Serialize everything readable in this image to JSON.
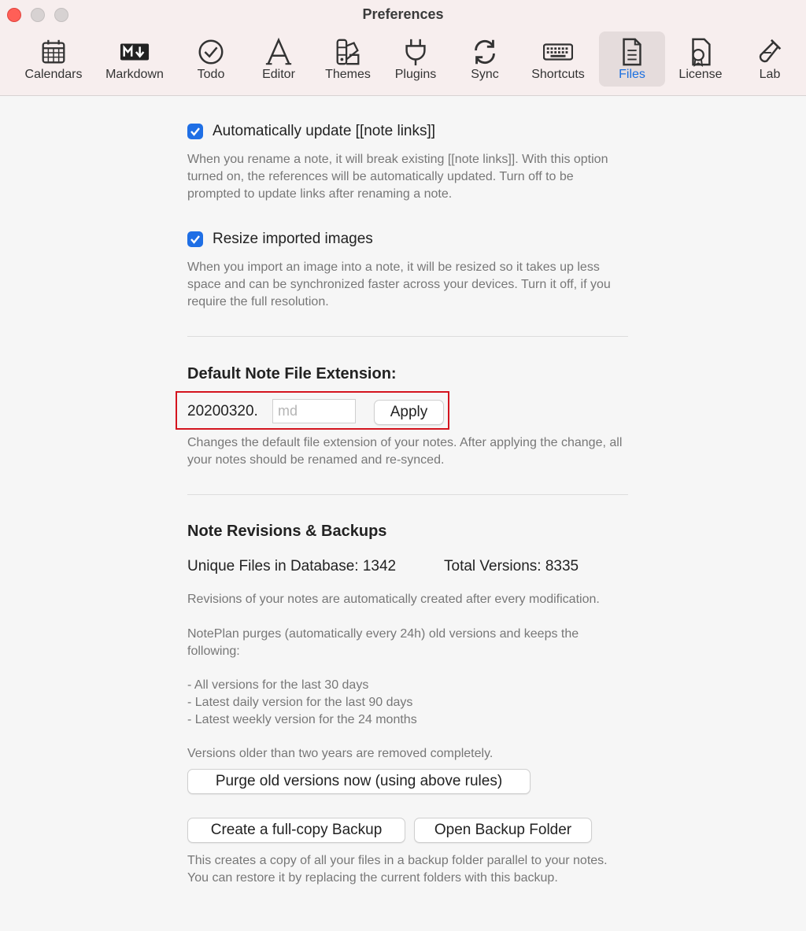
{
  "window": {
    "title": "Preferences"
  },
  "toolbar": {
    "items": [
      {
        "label": "Calendars",
        "icon": "calendar-icon"
      },
      {
        "label": "Markdown",
        "icon": "markdown-icon"
      },
      {
        "label": "Todo",
        "icon": "todo-check-icon"
      },
      {
        "label": "Editor",
        "icon": "editor-font-icon"
      },
      {
        "label": "Themes",
        "icon": "themes-palette-icon"
      },
      {
        "label": "Plugins",
        "icon": "plugin-plug-icon"
      },
      {
        "label": "Sync",
        "icon": "sync-icon"
      },
      {
        "label": "Shortcuts",
        "icon": "keyboard-icon"
      },
      {
        "label": "Files",
        "icon": "file-icon",
        "active": true
      },
      {
        "label": "License",
        "icon": "license-icon"
      },
      {
        "label": "Lab",
        "icon": "lab-flask-icon"
      }
    ],
    "active_color": "#1a6fe0"
  },
  "settings": {
    "update_links": {
      "label": "Automatically update [[note links]]",
      "checked": true,
      "description": "When you rename a note, it will break existing [[note links]]. With this option turned on, the references will be automatically updated. Turn off to be prompted to update links after renaming a note."
    },
    "resize_images": {
      "label": "Resize imported images",
      "checked": true,
      "description": "When you import an image into a note, it will be resized so it takes up less space and can be synchronized faster across your devices. Turn it off, if you require the full resolution."
    }
  },
  "extension": {
    "heading": "Default Note File Extension:",
    "prefix": "20200320.",
    "value": "",
    "placeholder": "md",
    "apply_label": "Apply",
    "description": "Changes the default file extension of your notes. After applying the change, all your notes should be renamed and re-synced."
  },
  "revisions": {
    "heading": "Note Revisions & Backups",
    "unique_files": "Unique Files in Database: 1342",
    "total_versions": "Total Versions: 8335",
    "desc_1": "Revisions of your notes are automatically created after every modification.",
    "desc_2": "NotePlan purges (automatically every 24h) old versions and keeps the following:",
    "rules": [
      "- All versions for the last 30 days",
      "- Latest daily version for the last 90 days",
      "- Latest weekly version for the 24 months"
    ],
    "desc_3": "Versions older than two years are removed completely.",
    "purge_label": "Purge old versions now (using above rules)",
    "backup_label": "Create a full-copy Backup",
    "open_folder_label": "Open Backup Folder",
    "backup_desc": "This creates a copy of all your files in a backup folder parallel to your notes. You can restore it by replacing the current folders with this backup."
  },
  "colors": {
    "accent": "#1f6fe5",
    "highlight_border": "#d4141e"
  }
}
